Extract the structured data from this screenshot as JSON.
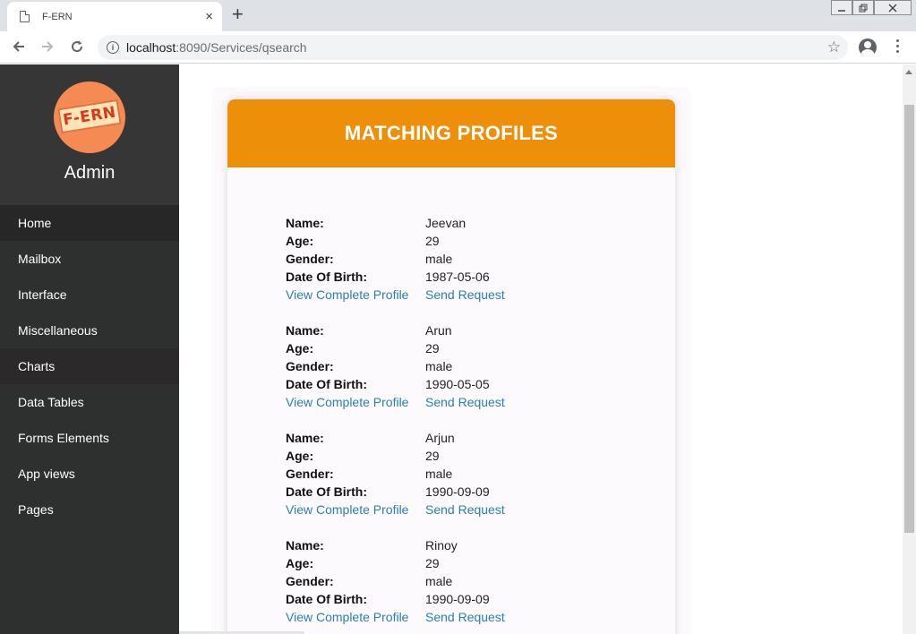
{
  "browser": {
    "tab_title": "F-ERN",
    "tab_close": "×",
    "new_tab": "+",
    "url_host": "localhost",
    "url_rest": ":8090/Services/qsearch",
    "window_controls": [
      "minimize",
      "restore",
      "close"
    ]
  },
  "sidebar": {
    "logo_text": "F-ERN",
    "user_name": "Admin",
    "items": [
      {
        "label": "Home"
      },
      {
        "label": "Mailbox"
      },
      {
        "label": "Interface"
      },
      {
        "label": "Miscellaneous"
      },
      {
        "label": "Charts"
      },
      {
        "label": "Data Tables"
      },
      {
        "label": "Forms Elements"
      },
      {
        "label": "App views"
      },
      {
        "label": "Pages"
      }
    ]
  },
  "main": {
    "title": "MATCHING PROFILES",
    "labels": {
      "name": "Name:",
      "age": "Age:",
      "gender": "Gender:",
      "dob": "Date Of Birth:"
    },
    "link_view": "View Complete Profile",
    "link_request": "Send Request",
    "profiles": [
      {
        "name": "Jeevan",
        "age": "29",
        "gender": "male",
        "dob": "1987-05-06"
      },
      {
        "name": "Arun",
        "age": "29",
        "gender": "male",
        "dob": "1990-05-05"
      },
      {
        "name": "Arjun",
        "age": "29",
        "gender": "male",
        "dob": "1990-09-09"
      },
      {
        "name": "Rinoy",
        "age": "29",
        "gender": "male",
        "dob": "1990-09-09"
      }
    ]
  },
  "colors": {
    "header_orange": "#ee8f0a",
    "sidebar_bg": "#2e2f2f",
    "link_blue": "#2a7fb1"
  }
}
